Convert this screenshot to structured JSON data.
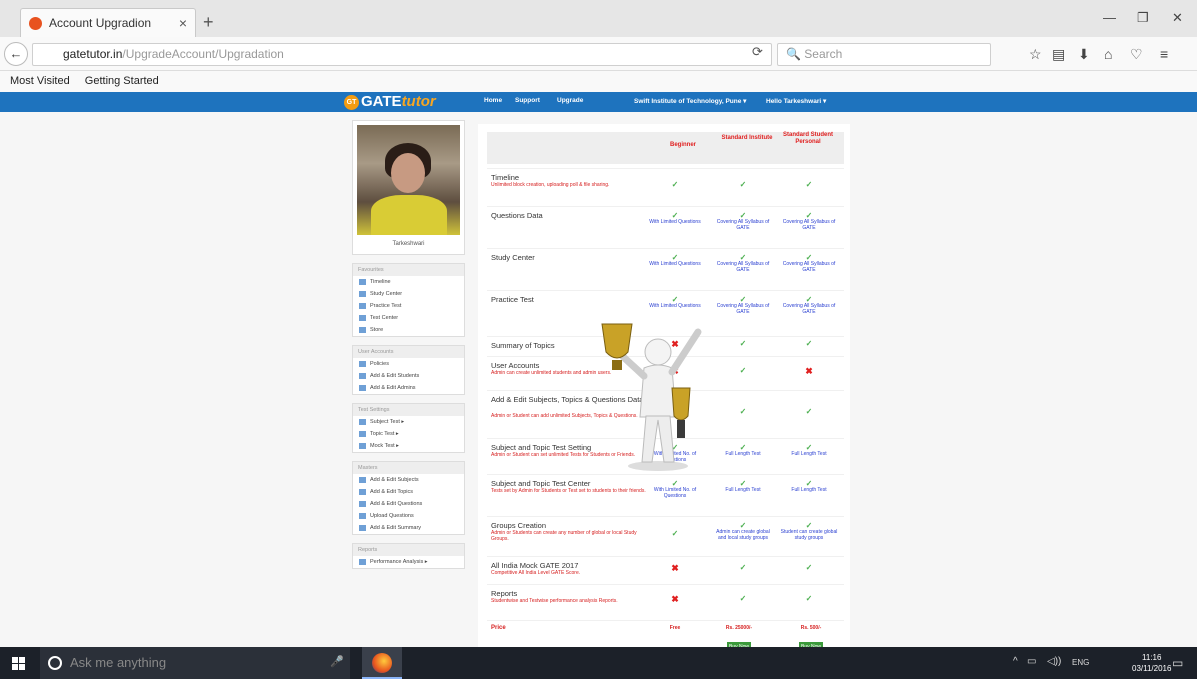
{
  "browser": {
    "tab_title": "Account Upgradion",
    "url_host": "gatetutor.in",
    "url_path": "/UpgradeAccount/Upgradation",
    "search_placeholder": "Search",
    "bookmarks": [
      "Most Visited",
      "Getting Started"
    ]
  },
  "site": {
    "logo_gate": "GATE",
    "logo_tutor": "tutor",
    "logo_badge": "GT",
    "nav": [
      "Home",
      "Support",
      "Upgrade",
      "Swift Institute of Technology, Pune ▾",
      "Hello Tarkeshwari ▾"
    ]
  },
  "sidebar": {
    "profile_name": "Tarkeshwari",
    "sections": [
      {
        "title": "Favourites",
        "items": [
          "Timeline",
          "Study Center",
          "Practice Test",
          "Test Center",
          "Store"
        ]
      },
      {
        "title": "User Accounts",
        "items": [
          "Policies",
          "Add & Edit Students",
          "Add & Edit Admins"
        ]
      },
      {
        "title": "Test Settings",
        "items": [
          "Subject Test ▸",
          "Topic Test ▸",
          "Mock Test ▸"
        ]
      },
      {
        "title": "Masters",
        "items": [
          "Add & Edit Subjects",
          "Add & Edit Topics",
          "Add & Edit Questions",
          "Upload Questions",
          "Add & Edit Summary"
        ]
      },
      {
        "title": "Reports",
        "items": [
          "Performance Analysis ▸"
        ]
      }
    ]
  },
  "plans": {
    "headers": [
      "Beginner",
      "Standard Institute",
      "Standard Student Personal"
    ],
    "rows": [
      {
        "title": "Timeline",
        "desc": "Unlimited block creation, uploading poll & file sharing.",
        "cells": [
          "check",
          "check",
          "check"
        ],
        "notes": [
          "",
          "",
          ""
        ]
      },
      {
        "title": "Questions Data",
        "desc": "",
        "cells": [
          "check",
          "check",
          "check"
        ],
        "notes": [
          "With Limited Questions",
          "Covering All Syllabus of GATE",
          "Covering All Syllabus of GATE"
        ]
      },
      {
        "title": "Study Center",
        "desc": "",
        "cells": [
          "check",
          "check",
          "check"
        ],
        "notes": [
          "With Limited Questions",
          "Covering All Syllabus of GATE",
          "Covering All Syllabus of GATE"
        ]
      },
      {
        "title": "Practice Test",
        "desc": "",
        "cells": [
          "check",
          "check",
          "check"
        ],
        "notes": [
          "With Limited Questions",
          "Covering All Syllabus of GATE",
          "Covering All Syllabus of GATE"
        ]
      },
      {
        "title": "Summary of Topics",
        "desc": "",
        "cells": [
          "cross",
          "check",
          "check"
        ],
        "notes": [
          "",
          "",
          ""
        ]
      },
      {
        "title": "User Accounts",
        "desc": "Admin can create unlimited students and admin users.",
        "cells": [
          "cross",
          "check",
          "cross"
        ],
        "notes": [
          "",
          "",
          ""
        ]
      },
      {
        "title": "Add & Edit Subjects, Topics & Questions Data",
        "desc": "Admin or Student can add unlimited Subjects, Topics & Questions.",
        "cells": [
          "check",
          "check",
          "check"
        ],
        "notes": [
          "",
          "",
          ""
        ]
      },
      {
        "title": "Subject and Topic Test Setting",
        "desc": "Admin or Student can set unlimited Tests for Students or Friends.",
        "cells": [
          "check",
          "check",
          "check"
        ],
        "notes": [
          "With Limited No. of Questions",
          "Full Length Test",
          "Full Length Test"
        ]
      },
      {
        "title": "Subject and Topic Test Center",
        "desc": "Tests set by Admin for Students or Test set to students to their friends.",
        "cells": [
          "check",
          "check",
          "check"
        ],
        "notes": [
          "With Limited No. of Questions",
          "Full Length Test",
          "Full Length Test"
        ]
      },
      {
        "title": "Groups Creation",
        "desc": "Admin or Students can create any number of global or local Study Groups.",
        "cells": [
          "check",
          "check",
          "check"
        ],
        "notes": [
          "",
          "Admin can create global and local study groups",
          "Student can create global study groups"
        ]
      },
      {
        "title": "All India Mock GATE 2017",
        "desc": "Competitive All India Level GATE Score.",
        "cells": [
          "cross",
          "check",
          "check"
        ],
        "notes": [
          "",
          "",
          ""
        ]
      },
      {
        "title": "Reports",
        "desc": "Studentwise and Testwise performance analysis Reports.",
        "cells": [
          "cross",
          "check",
          "check"
        ],
        "notes": [
          "",
          "",
          ""
        ]
      }
    ],
    "price_label": "Price",
    "prices": [
      "Free",
      "Rs. 25000/-",
      "Rs. 500/-"
    ],
    "buy_label": "Buy Now"
  },
  "taskbar": {
    "search_placeholder": "Ask me anything",
    "lang": "ENG",
    "time": "11:16",
    "date": "03/11/2016"
  }
}
